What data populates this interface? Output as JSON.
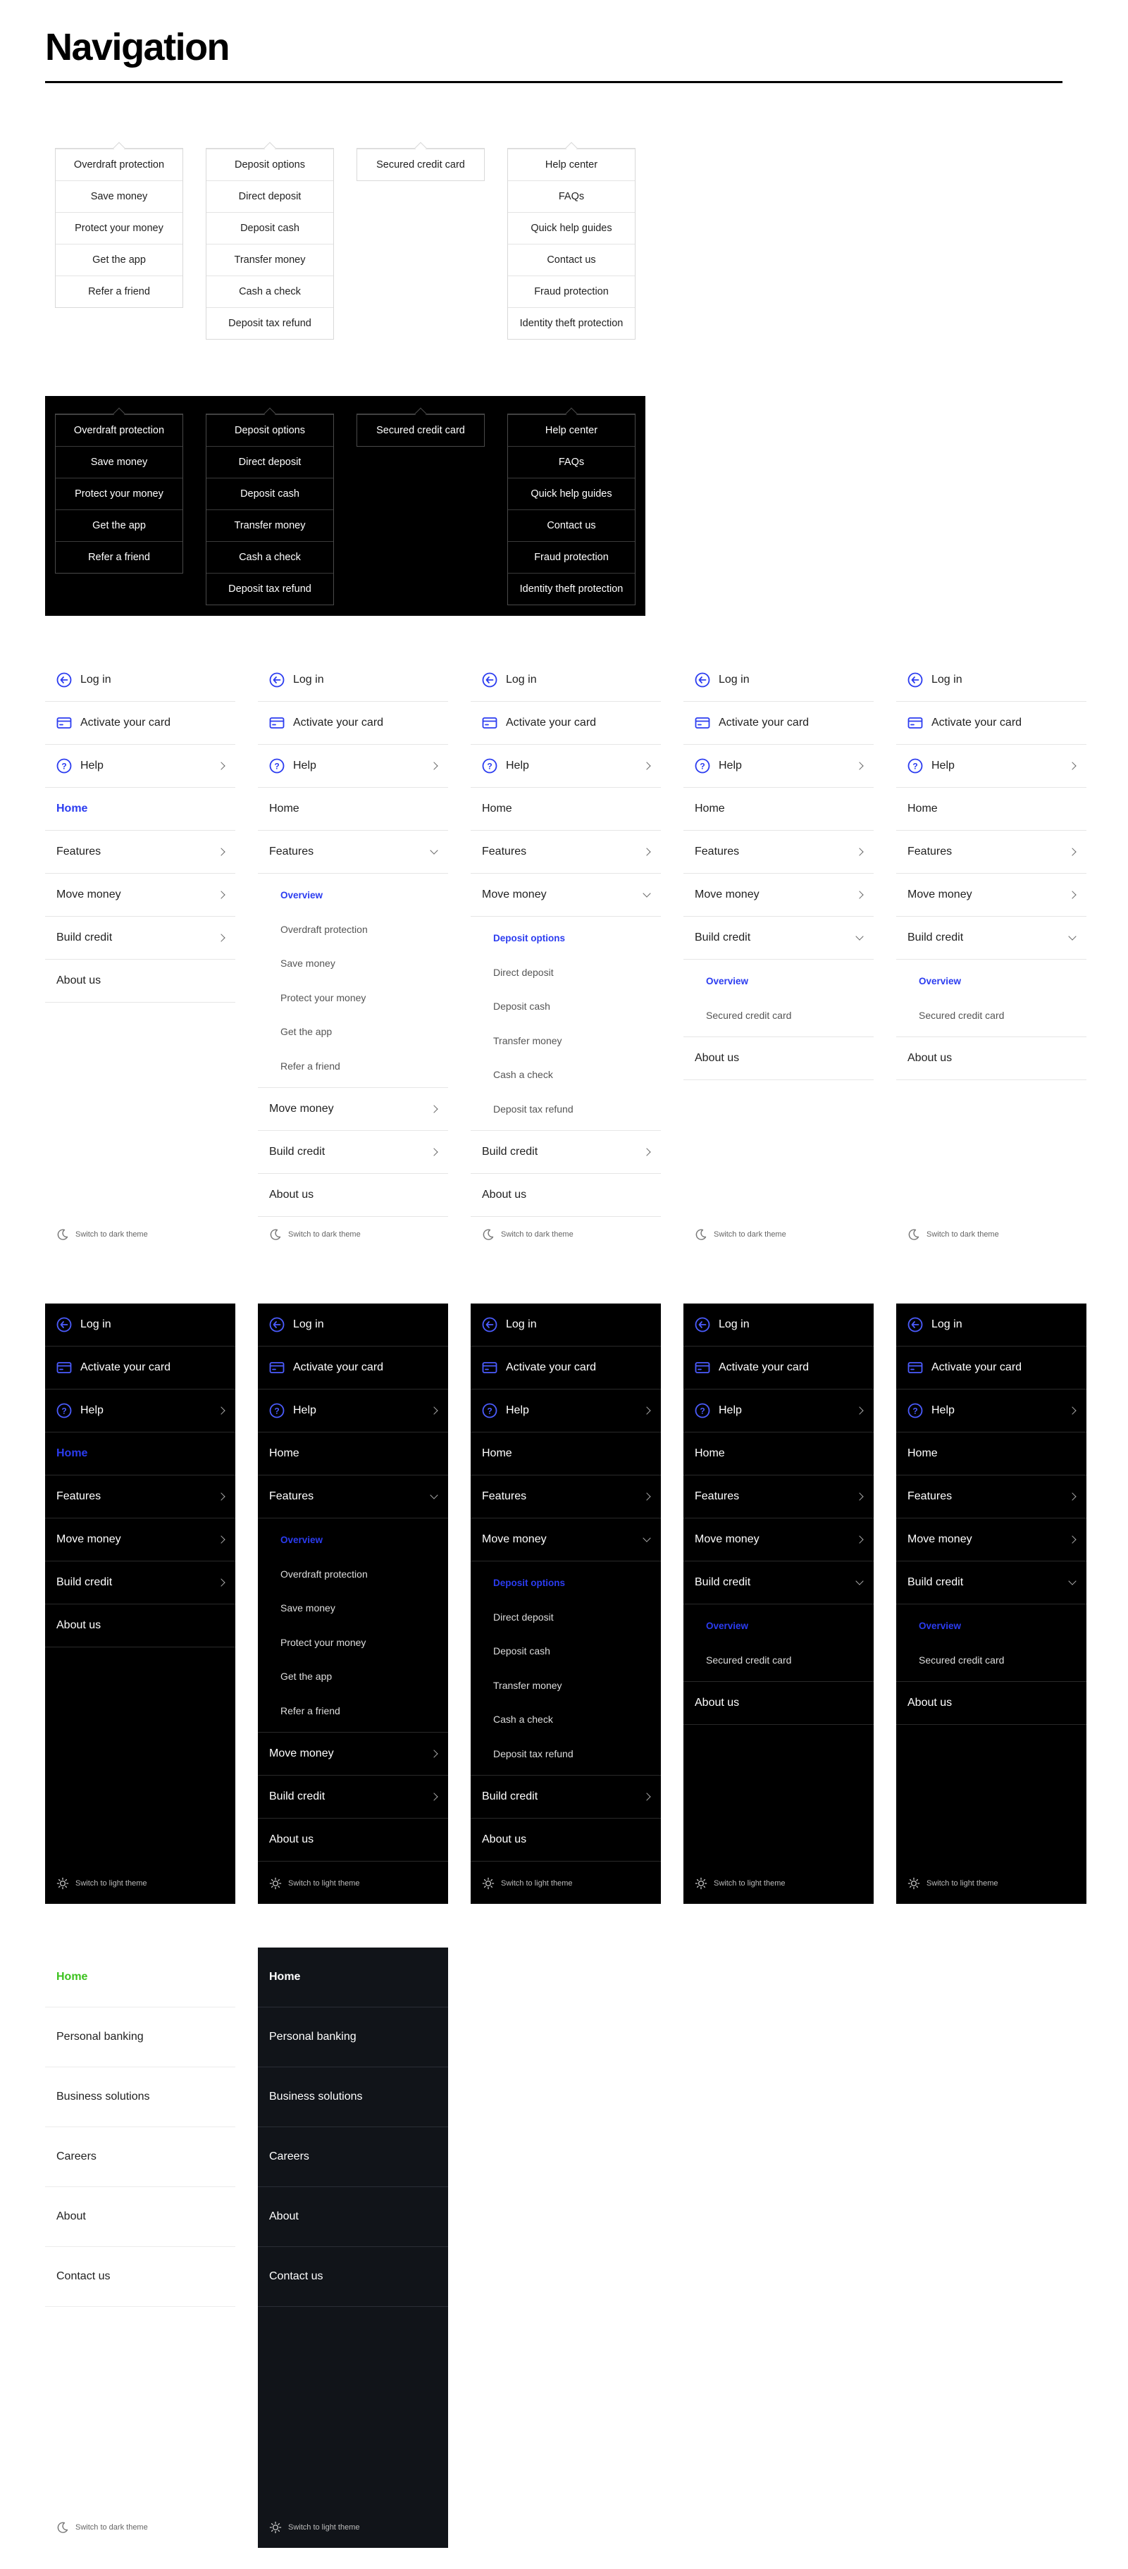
{
  "page": {
    "title": "Navigation"
  },
  "dropdowns": {
    "features": [
      "Overdraft protection",
      "Save money",
      "Protect your money",
      "Get the app",
      "Refer a friend"
    ],
    "move_money": [
      "Deposit options",
      "Direct deposit",
      "Deposit cash",
      "Transfer money",
      "Cash a check",
      "Deposit tax refund"
    ],
    "build_credit": [
      "Secured credit card"
    ],
    "help": [
      "Help center",
      "FAQs",
      "Quick help guides",
      "Contact us",
      "Fraud protection",
      "Identity theft protection"
    ]
  },
  "mobile": {
    "login": "Log in",
    "activate": "Activate your card",
    "help": "Help",
    "home": "Home",
    "features": "Features",
    "move_money": "Move money",
    "build_credit": "Build credit",
    "about": "About us",
    "overview": "Overview",
    "features_sub": [
      "Overdraft protection",
      "Save money",
      "Protect your money",
      "Get the app",
      "Refer a friend"
    ],
    "move_money_active": "Deposit options",
    "move_money_sub": [
      "Direct deposit",
      "Deposit cash",
      "Transfer money",
      "Cash a check",
      "Deposit tax refund"
    ],
    "build_credit_sub": [
      "Secured credit card"
    ],
    "to_dark": "Switch to dark theme",
    "to_light": "Switch to light theme"
  },
  "site_nav": {
    "items": [
      "Home",
      "Personal banking",
      "Business solutions",
      "Careers",
      "About",
      "Contact us"
    ],
    "to_dark": "Switch to dark theme",
    "to_light": "Switch to light theme"
  },
  "colors": {
    "accent_blue": "#2b3cf0",
    "active_green": "#3cc21e",
    "site_dark_bg": "#111419"
  }
}
